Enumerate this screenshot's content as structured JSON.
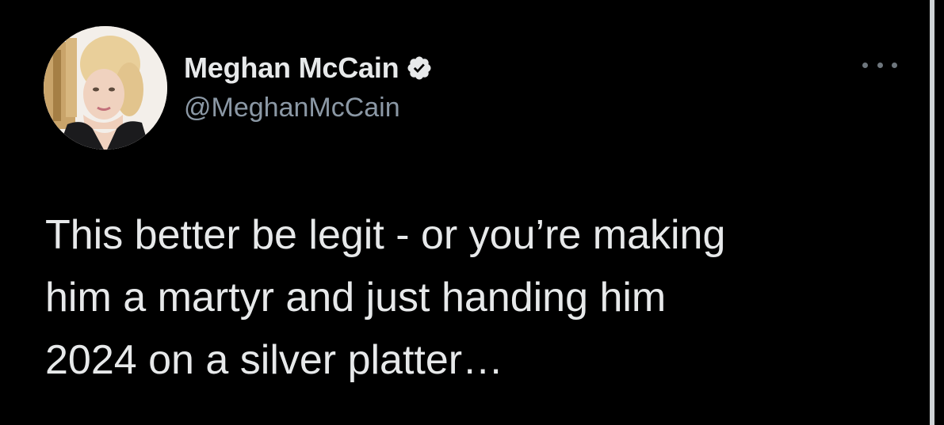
{
  "tweet": {
    "author": {
      "display_name": "Meghan McCain",
      "handle": "@MeghanMcCain",
      "verified": true
    },
    "text_lines": [
      "This better be legit - or you’re making",
      "him a martyr and just handing him",
      "2024 on a silver platter…"
    ],
    "more_icon": "more-horizontal-icon"
  },
  "colors": {
    "background": "#000000",
    "primary_text": "#e7e9ea",
    "secondary_text": "#8b98a5",
    "verified_badge": "#e7e9ea"
  }
}
